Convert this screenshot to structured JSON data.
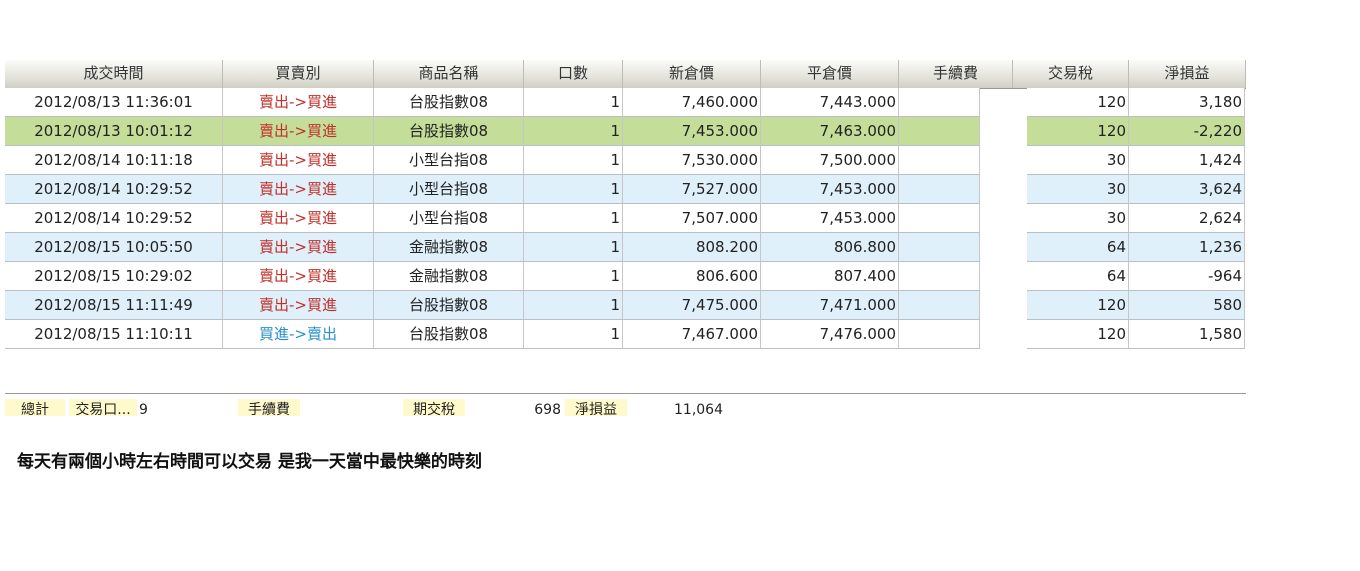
{
  "table": {
    "headers": [
      "成交時間",
      "買賣別",
      "商品名稱",
      "口數",
      "新倉價",
      "平倉價",
      "手續費",
      "交易稅",
      "淨損益"
    ],
    "rows": [
      {
        "time": "2012/08/13 11:36:01",
        "side": "賣出->買進",
        "product": "台股指數08",
        "qty": "1",
        "open": "7,460.000",
        "close": "7,443.000",
        "fee": "",
        "tax": "120",
        "pnl": "3,180"
      },
      {
        "time": "2012/08/13 10:01:12",
        "side": "賣出->買進",
        "product": "台股指數08",
        "qty": "1",
        "open": "7,453.000",
        "close": "7,463.000",
        "fee": "",
        "tax": "120",
        "pnl": "-2,220"
      },
      {
        "time": "2012/08/14 10:11:18",
        "side": "賣出->買進",
        "product": "小型台指08",
        "qty": "1",
        "open": "7,530.000",
        "close": "7,500.000",
        "fee": "",
        "tax": "30",
        "pnl": "1,424"
      },
      {
        "time": "2012/08/14 10:29:52",
        "side": "賣出->買進",
        "product": "小型台指08",
        "qty": "1",
        "open": "7,527.000",
        "close": "7,453.000",
        "fee": "",
        "tax": "30",
        "pnl": "3,624"
      },
      {
        "time": "2012/08/14 10:29:52",
        "side": "賣出->買進",
        "product": "小型台指08",
        "qty": "1",
        "open": "7,507.000",
        "close": "7,453.000",
        "fee": "",
        "tax": "30",
        "pnl": "2,624"
      },
      {
        "time": "2012/08/15 10:05:50",
        "side": "賣出->買進",
        "product": "金融指數08",
        "qty": "1",
        "open": "808.200",
        "close": "806.800",
        "fee": "",
        "tax": "64",
        "pnl": "1,236"
      },
      {
        "time": "2012/08/15 10:29:02",
        "side": "賣出->買進",
        "product": "金融指數08",
        "qty": "1",
        "open": "806.600",
        "close": "807.400",
        "fee": "",
        "tax": "64",
        "pnl": "-964"
      },
      {
        "time": "2012/08/15 11:11:49",
        "side": "賣出->買進",
        "product": "台股指數08",
        "qty": "1",
        "open": "7,475.000",
        "close": "7,471.000",
        "fee": "",
        "tax": "120",
        "pnl": "580"
      },
      {
        "time": "2012/08/15 11:10:11",
        "side": "買進->賣出",
        "product": "台股指數08",
        "qty": "1",
        "open": "7,467.000",
        "close": "7,476.000",
        "fee": "",
        "tax": "120",
        "pnl": "1,580"
      }
    ],
    "selected_row_color": "#c4de9a",
    "alt_row_color": "#e0f0fb",
    "sell_color": "#c0302a",
    "buy_color": "#2a8fc8"
  },
  "summary": {
    "total_label": "總計",
    "trade_qty_label": "交易口...",
    "trade_qty_value": "9",
    "fee_label": "手續費",
    "fee_value": "",
    "tax_label": "期交稅",
    "tax_value": "698",
    "pnl_label": "淨損益",
    "pnl_value": "11,064"
  },
  "caption": "每天有兩個小時左右時間可以交易 是我一天當中最快樂的時刻"
}
